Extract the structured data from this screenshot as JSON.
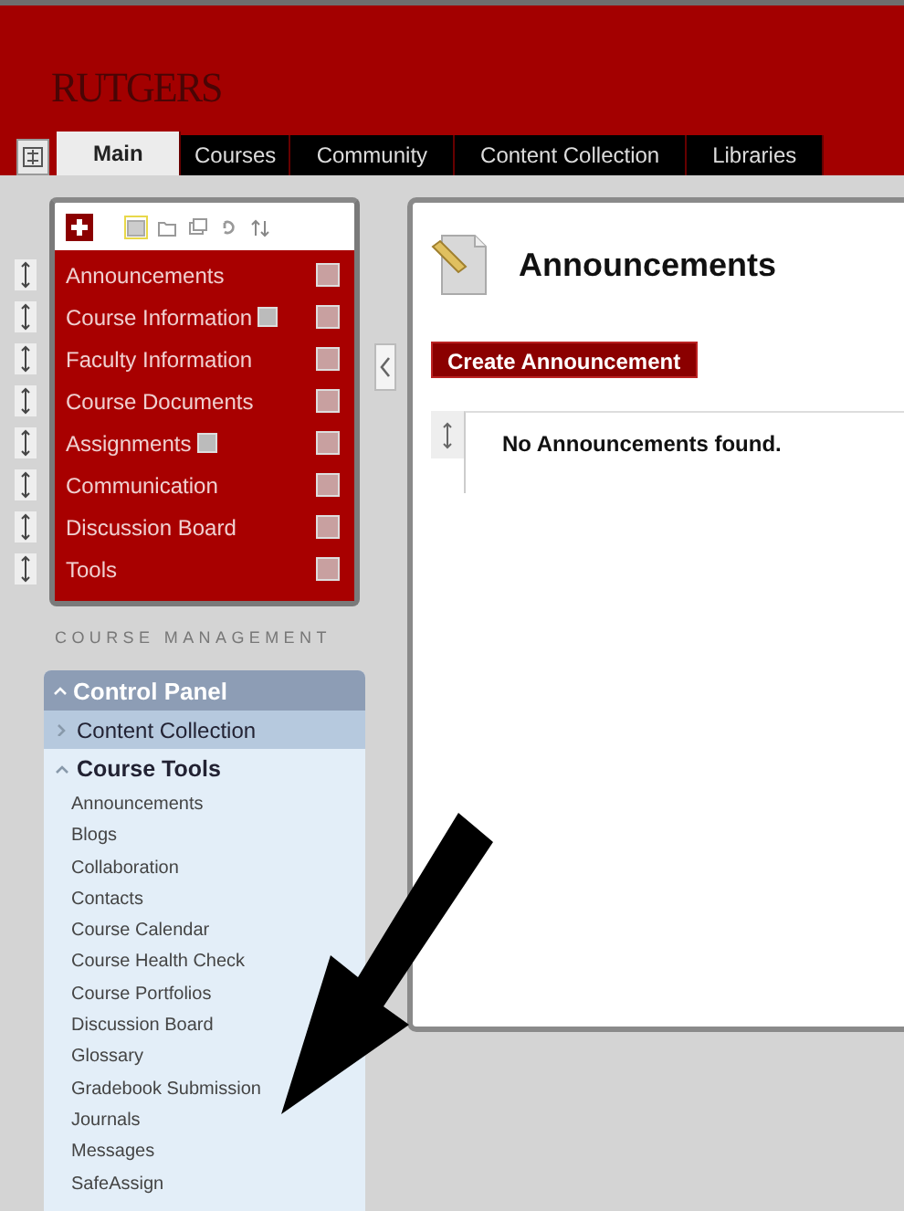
{
  "logo": "RUTGERS",
  "tabs": [
    {
      "label": "Main",
      "selected": true
    },
    {
      "label": "Courses",
      "selected": false
    },
    {
      "label": "Community",
      "selected": false
    },
    {
      "label": "Content Collection",
      "selected": false
    },
    {
      "label": "Libraries",
      "selected": false
    }
  ],
  "course_menu": {
    "items": [
      {
        "label": "Announcements",
        "badge": false
      },
      {
        "label": "Course Information",
        "badge": true
      },
      {
        "label": "Faculty Information",
        "badge": false
      },
      {
        "label": "Course Documents",
        "badge": false
      },
      {
        "label": "Assignments",
        "badge": true
      },
      {
        "label": "Communication",
        "badge": false
      },
      {
        "label": "Discussion Board",
        "badge": false
      },
      {
        "label": "Tools",
        "badge": false
      }
    ]
  },
  "section_title": "COURSE MANAGEMENT",
  "control_panel": {
    "title": "Control Panel",
    "expanded": true,
    "sections": [
      {
        "label": "Content Collection",
        "expanded": false
      },
      {
        "label": "Course Tools",
        "expanded": true,
        "items": [
          "Announcements",
          "Blogs",
          "Collaboration",
          "Contacts",
          "Course Calendar",
          "Course Health Check",
          "Course Portfolios",
          "Discussion Board",
          "Glossary",
          "Gradebook Submission",
          "Journals",
          "Messages",
          "SafeAssign"
        ]
      }
    ]
  },
  "content": {
    "title": "Announcements",
    "button": "Create Announcement",
    "empty_message": "No Announcements found."
  }
}
